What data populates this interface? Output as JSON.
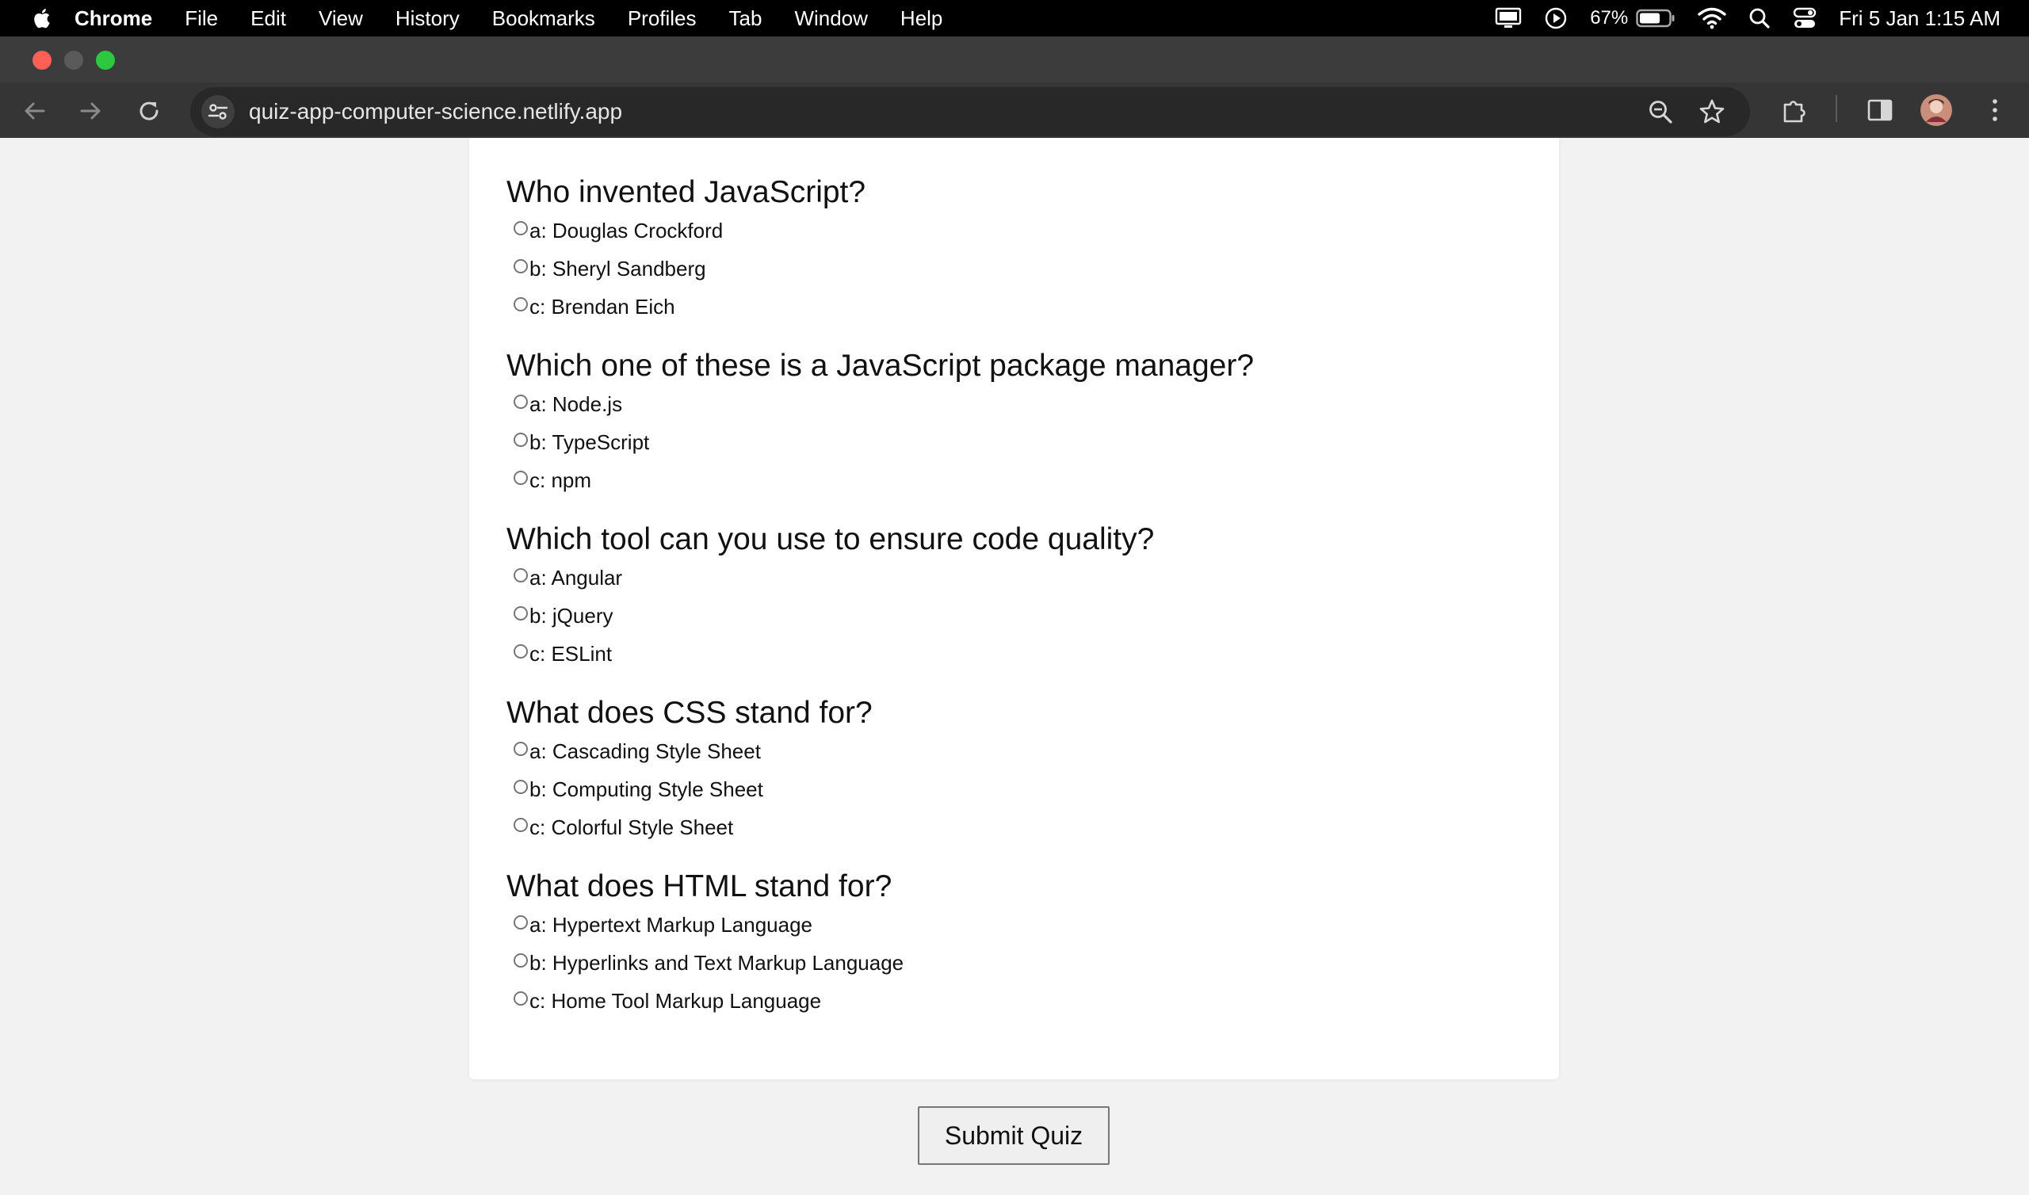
{
  "menubar": {
    "app_name": "Chrome",
    "items": [
      "File",
      "Edit",
      "View",
      "History",
      "Bookmarks",
      "Profiles",
      "Tab",
      "Window",
      "Help"
    ],
    "battery_percent": "67%",
    "clock": "Fri 5 Jan  1:15 AM"
  },
  "browser": {
    "url": "quiz-app-computer-science.netlify.app"
  },
  "quiz": {
    "questions": [
      {
        "text": "Who invented JavaScript?",
        "options": [
          "a: Douglas Crockford",
          "b: Sheryl Sandberg",
          "c: Brendan Eich"
        ]
      },
      {
        "text": "Which one of these is a JavaScript package manager?",
        "options": [
          "a: Node.js",
          "b: TypeScript",
          "c: npm"
        ]
      },
      {
        "text": "Which tool can you use to ensure code quality?",
        "options": [
          "a: Angular",
          "b: jQuery",
          "c: ESLint"
        ]
      },
      {
        "text": "What does CSS stand for?",
        "options": [
          "a: Cascading Style Sheet",
          "b: Computing Style Sheet",
          "c: Colorful Style Sheet"
        ]
      },
      {
        "text": "What does HTML stand for?",
        "options": [
          "a: Hypertext Markup Language",
          "b: Hyperlinks and Text Markup Language",
          "c: Home Tool Markup Language"
        ]
      }
    ],
    "submit_label": "Submit Quiz"
  }
}
